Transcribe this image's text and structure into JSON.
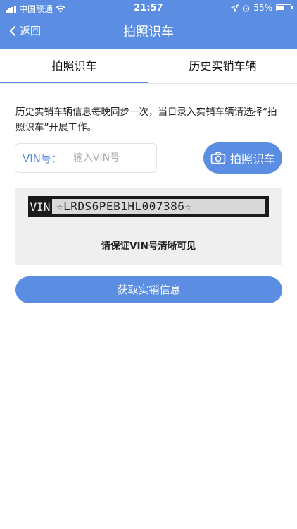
{
  "status_bar": {
    "carrier": "中国联通",
    "time": "21:57",
    "battery_percent": "55%",
    "battery_level": 0.55,
    "icons": [
      "signal-icon",
      "wifi-icon",
      "location-arrow-icon",
      "alarm-icon",
      "battery-icon"
    ]
  },
  "nav": {
    "back_label": "返回",
    "title": "拍照识车"
  },
  "tabs": [
    {
      "label": "拍照识车",
      "active": true
    },
    {
      "label": "历史实销车辆",
      "active": false
    }
  ],
  "notice": "历史实销车辆信息每晚同步一次，当日录入实销车辆请选择“拍照识车”开展工作。",
  "vin_field": {
    "label": "VIN号：",
    "value": "",
    "placeholder": "输入VIN号"
  },
  "photo_button": {
    "label": "拍照识车",
    "icon": "camera-icon"
  },
  "sample": {
    "plate_prefix": "VIN",
    "plate_code": "☆LRDS6PEB1HL007386☆",
    "caption": "请保证VIN号清晰可见"
  },
  "submit_button": {
    "label": "获取实销信息"
  },
  "colors": {
    "primary": "#5b8ee3",
    "panel_bg": "#efefef",
    "text": "#222222"
  }
}
